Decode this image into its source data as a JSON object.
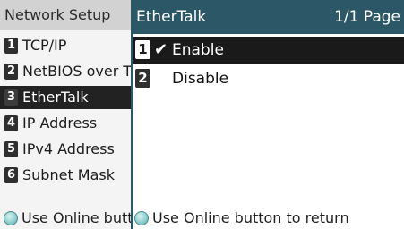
{
  "background_menu": {
    "title": "Network Setup",
    "items": [
      {
        "number": "1",
        "label": "TCP/IP"
      },
      {
        "number": "2",
        "label": "NetBIOS over TCP"
      },
      {
        "number": "3",
        "label": "EtherTalk"
      },
      {
        "number": "4",
        "label": "IP Address"
      },
      {
        "number": "5",
        "label": "IPv4 Address"
      },
      {
        "number": "6",
        "label": "Subnet Mask"
      }
    ],
    "footer": "Use Online button to return"
  },
  "popup": {
    "title": "EtherTalk",
    "page": "1/1 Page",
    "options": [
      {
        "number": "1",
        "label": "Enable",
        "checked": true
      },
      {
        "number": "2",
        "label": "Disable",
        "checked": false
      }
    ],
    "footer": "Use Online button to return"
  },
  "colors": {
    "header_accent": "#2b5766",
    "selected_row": "#1a1a1a",
    "online_button": "#8fcfd0"
  },
  "icons": {
    "checked_option": "check-icon",
    "footer_button": "online-button-icon"
  }
}
